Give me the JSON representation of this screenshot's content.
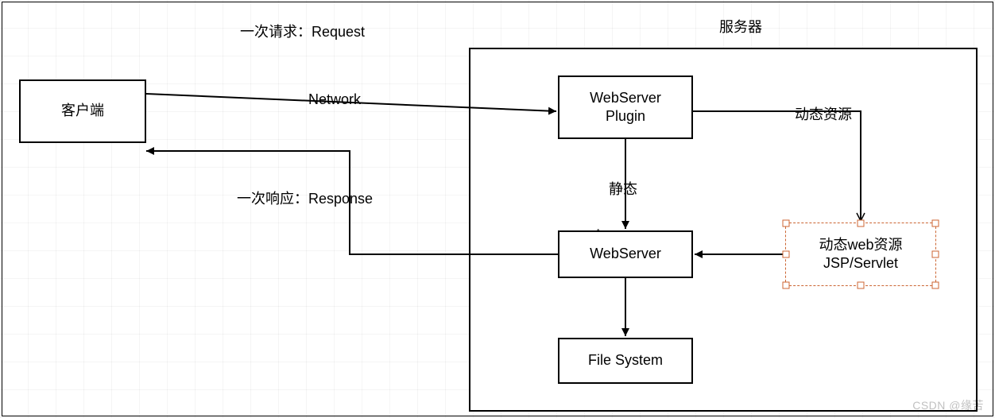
{
  "title_request": "一次请求：Request",
  "title_response": "一次响应：Response",
  "server_label": "服务器",
  "nodes": {
    "client": "客户端",
    "webserver_plugin_l1": "WebServer",
    "webserver_plugin_l2": "Plugin",
    "webserver": "WebServer",
    "file_system": "File System",
    "dynamic_l1": "动态web资源",
    "dynamic_l2": "JSP/Servlet"
  },
  "edges": {
    "network": "Network",
    "dynamic_resource": "动态资源",
    "static": "静态"
  },
  "watermark": "CSDN @缘苦"
}
